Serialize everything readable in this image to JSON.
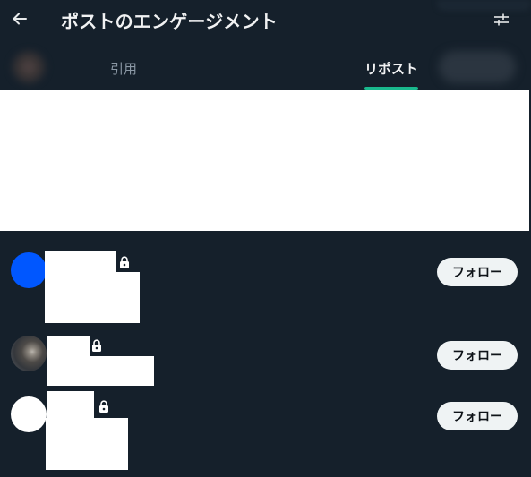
{
  "header": {
    "title": "ポストのエンゲージメント",
    "back_icon": "arrow-left-icon",
    "settings_icon": "sliders-icon"
  },
  "tabs": [
    {
      "label": "引用",
      "selected": false
    },
    {
      "label": "リポスト",
      "selected": true
    }
  ],
  "colors": {
    "background": "#15202b",
    "tab_indicator": "#1ab98e",
    "follow_button_bg": "#eff3f4",
    "follow_button_text": "#0f1419"
  },
  "users": [
    {
      "avatar": "blue-avatar",
      "protected": true,
      "follow_label": "フォロー"
    },
    {
      "avatar": "photo-avatar",
      "protected": true,
      "follow_label": "フォロー"
    },
    {
      "avatar": "white-avatar",
      "protected": true,
      "follow_label": "フォロー"
    }
  ]
}
